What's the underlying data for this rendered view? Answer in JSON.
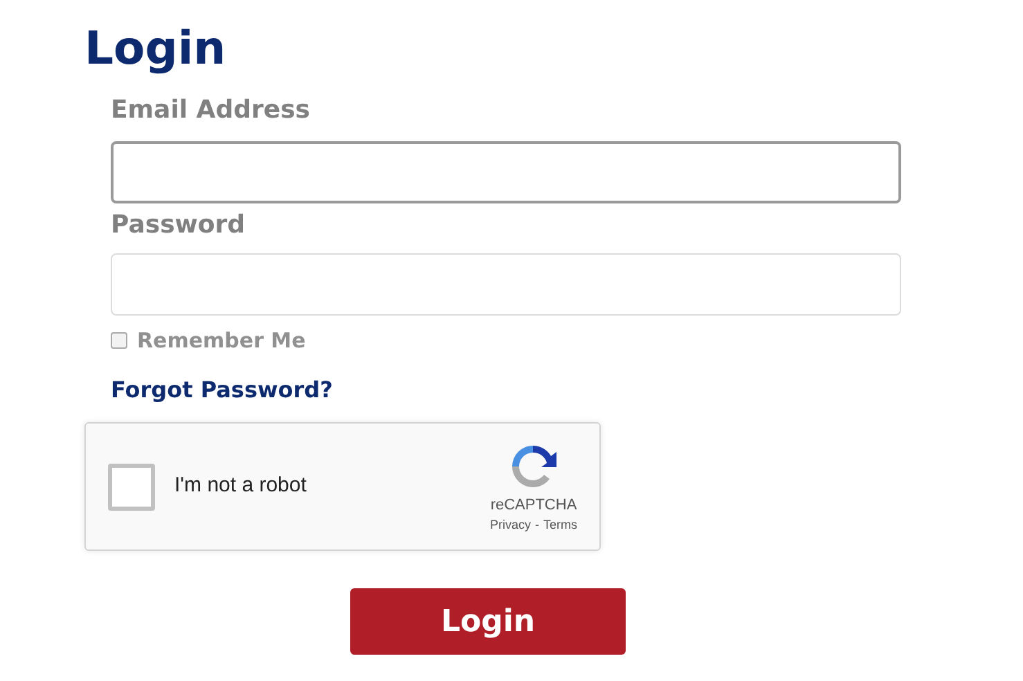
{
  "title": "Login",
  "fields": [
    {
      "label": "Email Address",
      "focused": true
    },
    {
      "label": "Password",
      "focused": false
    }
  ],
  "remember": {
    "label": "Remember Me",
    "checked": false
  },
  "forgot_link": "Forgot Password?",
  "captcha": {
    "label": "I'm not a robot",
    "checked": false,
    "brand": "reCAPTCHA",
    "privacy": "Privacy",
    "separator": "-",
    "terms": "Terms"
  },
  "submit": "Login"
}
